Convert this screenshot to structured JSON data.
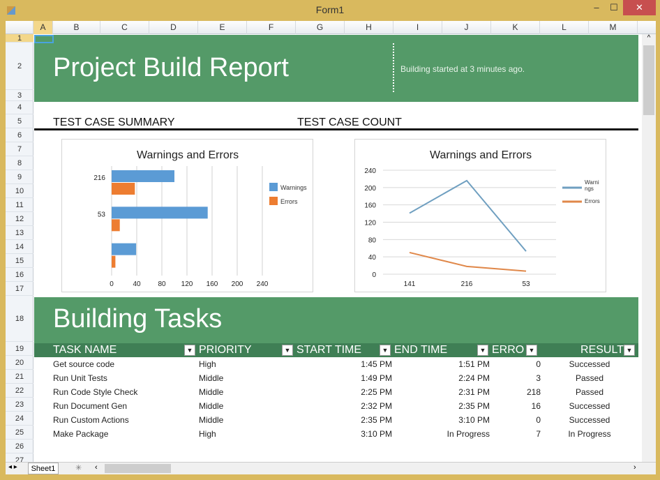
{
  "window": {
    "title": "Form1",
    "minimize": "–",
    "maximize": "☐",
    "close": "✕"
  },
  "columns": [
    "A",
    "B",
    "C",
    "D",
    "E",
    "F",
    "G",
    "H",
    "I",
    "J",
    "K",
    "L",
    "M"
  ],
  "rows": [
    "1",
    "2",
    "3",
    "4",
    "5",
    "6",
    "7",
    "8",
    "9",
    "10",
    "11",
    "12",
    "13",
    "14",
    "15",
    "16",
    "17",
    "18",
    "19",
    "20",
    "21",
    "22",
    "23",
    "24",
    "25",
    "26",
    "27"
  ],
  "header": {
    "title": "Project Build Report",
    "status": "Building started at 3 minutes ago."
  },
  "sections": {
    "summary": "TEST CASE SUMMARY",
    "count": "TEST CASE COUNT",
    "tasks": "Building Tasks"
  },
  "colors": {
    "green": "#549a68",
    "header_row": "#3f7f55",
    "warnings": "#5b9bd5",
    "errors": "#ed7d31"
  },
  "chart_data": [
    {
      "type": "bar",
      "orientation": "horizontal",
      "title": "Warnings and Errors",
      "categories": [
        "216",
        "53",
        ""
      ],
      "series": [
        {
          "name": "Warnings",
          "values": [
            100,
            153,
            39
          ]
        },
        {
          "name": "Errors",
          "values": [
            37,
            13,
            6
          ]
        }
      ],
      "xticks": [
        "0",
        "40",
        "80",
        "120",
        "160",
        "200",
        "240"
      ],
      "xlim": [
        0,
        240
      ],
      "grid": true,
      "legend": "right"
    },
    {
      "type": "line",
      "title": "Warnings and Errors",
      "categories": [
        "141",
        "216",
        "53"
      ],
      "series": [
        {
          "name": "Warnings",
          "legend_label": "Warni ngs",
          "values": [
            141,
            216,
            53
          ]
        },
        {
          "name": "Errors",
          "values": [
            50,
            18,
            7
          ]
        }
      ],
      "yticks": [
        "0",
        "40",
        "80",
        "120",
        "160",
        "200",
        "240"
      ],
      "ylim": [
        0,
        240
      ],
      "grid": true,
      "legend": "right"
    }
  ],
  "table": {
    "headers": [
      "TASK NAME",
      "PRIORITY",
      "START TIME",
      "END TIME",
      "ERRO",
      "RESULT"
    ],
    "rows": [
      [
        "Get source code",
        "High",
        "1:45 PM",
        "1:51 PM",
        "0",
        "Successed"
      ],
      [
        "Run Unit Tests",
        "Middle",
        "1:49 PM",
        "2:24 PM",
        "3",
        "Passed"
      ],
      [
        "Run Code Style Check",
        "Middle",
        "2:25 PM",
        "2:31 PM",
        "218",
        "Passed"
      ],
      [
        "Run Document Gen",
        "Middle",
        "2:32 PM",
        "2:35 PM",
        "16",
        "Successed"
      ],
      [
        "Run Custom Actions",
        "Middle",
        "2:35 PM",
        "3:10 PM",
        "0",
        "Successed"
      ],
      [
        "Make Package",
        "High",
        "3:10 PM",
        "In Progress",
        "7",
        "In Progress"
      ]
    ]
  },
  "sheet_tabs": {
    "active": "Sheet1",
    "new": "✳"
  }
}
